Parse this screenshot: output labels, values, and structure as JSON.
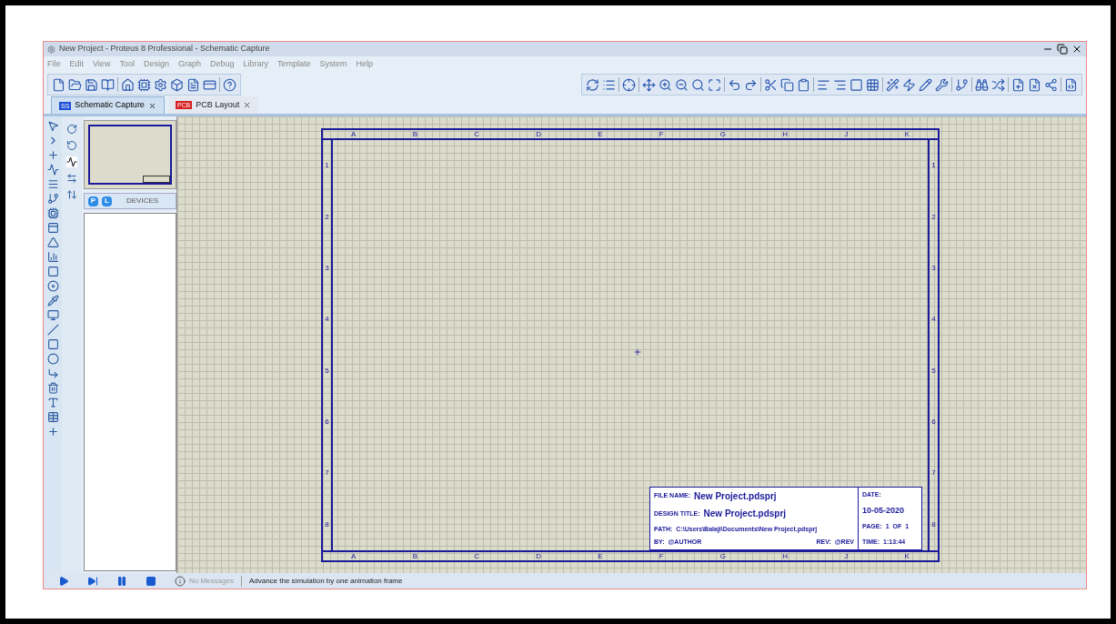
{
  "window": {
    "title": "New Project - Proteus 8 Professional - Schematic Capture"
  },
  "menu": [
    "File",
    "Edit",
    "View",
    "Tool",
    "Design",
    "Graph",
    "Debug",
    "Library",
    "Template",
    "System",
    "Help"
  ],
  "tabs": [
    {
      "label": "Schematic Capture",
      "badge": "SS",
      "color": "#1f4fd8",
      "selected": true
    },
    {
      "label": "PCB Layout",
      "badge": "PCB",
      "color": "#d82020",
      "selected": false
    }
  ],
  "device_panel": {
    "buttons": [
      "P",
      "L"
    ],
    "title": "DEVICES"
  },
  "sheet": {
    "top_labels": [
      "A",
      "B",
      "C",
      "D",
      "E",
      "F",
      "G",
      "H",
      "J",
      "K"
    ],
    "bottom_labels": [
      "A",
      "B",
      "C",
      "D",
      "E",
      "F",
      "G",
      "H",
      "J",
      "K"
    ],
    "left_labels": [
      "1",
      "2",
      "3",
      "4",
      "5",
      "6",
      "7",
      "8"
    ],
    "right_labels": [
      "1",
      "2",
      "3",
      "4",
      "5",
      "6",
      "7",
      "8"
    ],
    "title_block": {
      "file_name_label": "FILE NAME:",
      "file_name": "New Project.pdsprj",
      "design_title_label": "DESIGN TITLE:",
      "design_title": "New Project.pdsprj",
      "path_label": "PATH:",
      "path": "C:\\Users\\Balaji\\Documents\\New Project.pdsprj",
      "by_label": "BY:",
      "by": "@AUTHOR",
      "rev_label": "REV:",
      "rev": "@REV",
      "date_label": "DATE:",
      "date": "10-05-2020",
      "page_label": "PAGE:",
      "page": "1",
      "of_label": "OF",
      "of": "1",
      "time_label": "TIME:",
      "time": "1:13:44"
    }
  },
  "status_bar": {
    "messages": "No Messages",
    "hint": "Advance the simulation by one animation frame"
  }
}
